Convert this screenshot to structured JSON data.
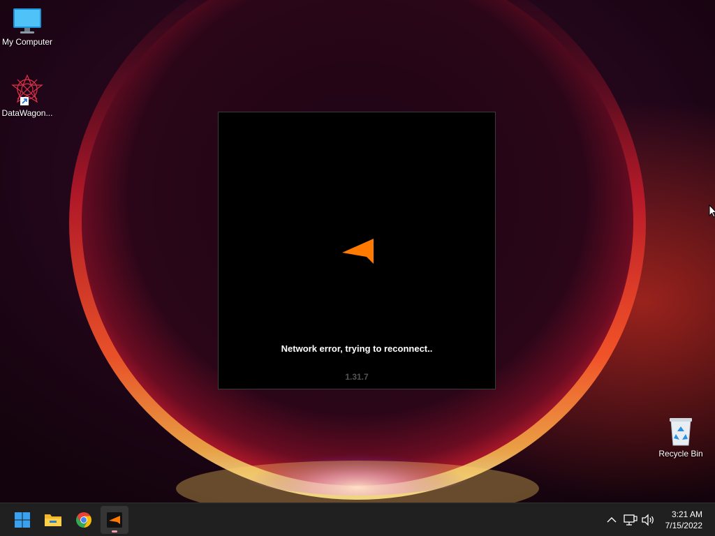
{
  "desktop": {
    "icons": [
      {
        "label": "My Computer",
        "icon": "monitor-icon"
      },
      {
        "label": "DataWagon...",
        "icon": "datawagon-shortcut-icon"
      },
      {
        "label": "Recycle Bin",
        "icon": "recycle-bin-icon"
      }
    ]
  },
  "launcher": {
    "status": "Network error, trying to reconnect..",
    "version": "1.31.7",
    "logo_color": "#ff7a00"
  },
  "taskbar": {
    "apps": [
      {
        "name": "Start",
        "icon": "windows-start-icon"
      },
      {
        "name": "File Explorer",
        "icon": "folder-icon"
      },
      {
        "name": "Google Chrome",
        "icon": "chrome-icon"
      },
      {
        "name": "Launcher",
        "icon": "launcher-app-icon",
        "active": true
      }
    ],
    "tray": {
      "icons": [
        "chevron-up-icon",
        "network-icon",
        "volume-icon"
      ],
      "time": "3:21 AM",
      "date": "7/15/2022"
    }
  }
}
